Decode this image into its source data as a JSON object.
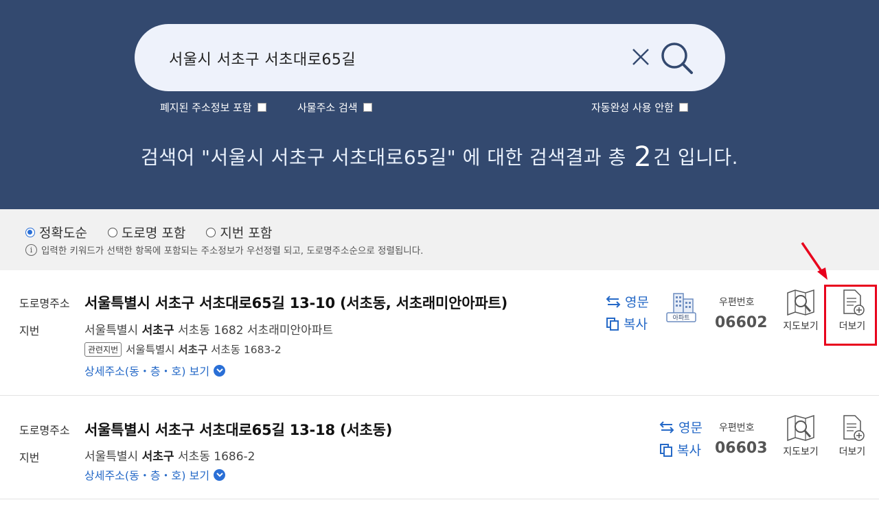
{
  "search": {
    "query": "서울시 서초구 서초대로65길",
    "clear_icon": "close-icon",
    "search_icon": "search-icon"
  },
  "options": {
    "closed_address": "폐지된 주소정보 포함",
    "thing_address": "사물주소 검색",
    "no_autocomplete": "자동완성 사용 안함"
  },
  "summary": {
    "prefix": "검색어 \"서울시 서초구 서초대로65길\" 에 대한 검색결과 총",
    "count": "2",
    "suffix": "건 입니다."
  },
  "sort": {
    "options": [
      "정확도순",
      "도로명 포함",
      "지번 포함"
    ],
    "selected": "정확도순",
    "note": "입력한 키워드가 선택한 항목에 포함되는 주소정보가 우선정렬 되고, 도로명주소순으로 정렬됩니다."
  },
  "labels": {
    "road": "도로명주소",
    "jibun": "지번",
    "english": "영문",
    "copy": "복사",
    "zip_label": "우편번호",
    "map": "지도보기",
    "more": "더보기",
    "detail": "상세주소(동・층・호) 보기",
    "related_jibun": "관련지번",
    "apartment": "아파트"
  },
  "results": [
    {
      "road_address": "서울특별시 서초구 서초대로65길 13-10 (서초동, 서초래미안아파트)",
      "jibun_pre": "서울특별시",
      "jibun_bold": "서초구",
      "jibun_post": "서초동 1682 서초래미안아파트",
      "related_pre": "서울특별시",
      "related_bold": "서초구",
      "related_post": "서초동 1683-2",
      "zip": "06602"
    },
    {
      "road_address": "서울특별시 서초구 서초대로65길 13-18 (서초동)",
      "jibun_pre": "서울특별시",
      "jibun_bold": "서초구",
      "jibun_post": "서초동 1686-2",
      "zip": "06603"
    }
  ],
  "colors": {
    "header_bg": "#33496f",
    "accent": "#2a6fd6",
    "highlight": "#e8001c"
  }
}
